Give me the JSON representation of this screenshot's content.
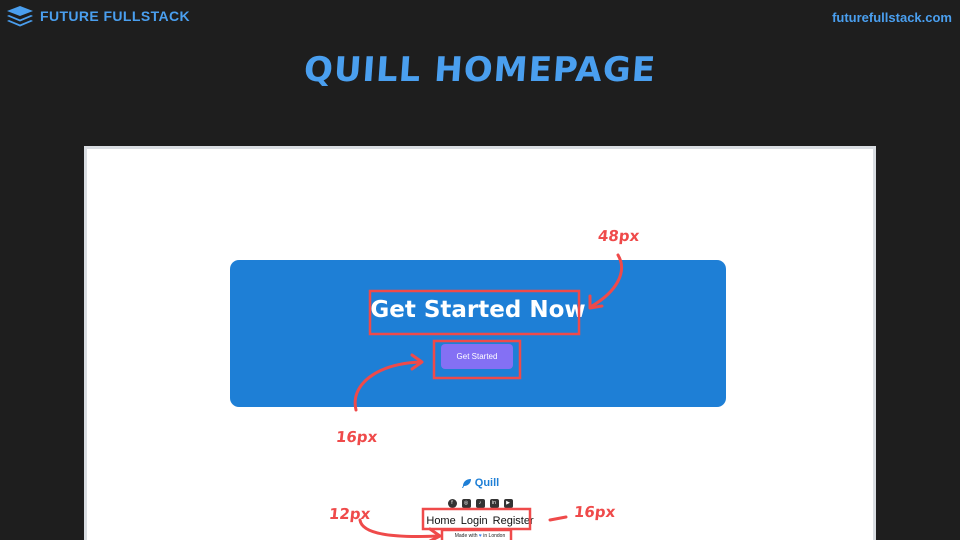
{
  "header": {
    "brand_name": "FUTURE FULLSTACK",
    "brand_icon": "stack-layers-icon",
    "site_url": "futurefullstack.com",
    "title": "QUILL HOMEPAGE"
  },
  "page": {
    "cta": {
      "heading": "Get Started Now",
      "button_label": "Get Started"
    },
    "footer": {
      "logo_icon": "feather-icon",
      "logo_text": "Quill",
      "socials": [
        "facebook-icon",
        "instagram-icon",
        "tiktok-icon",
        "linkedin-icon",
        "youtube-icon"
      ],
      "nav": [
        "Home",
        "Login",
        "Register"
      ],
      "made_with_prefix": "Made with",
      "made_with_suffix": "in London"
    }
  },
  "annotations": {
    "heading_size": "48px",
    "button_size": "16px",
    "nav_size": "16px",
    "made_with_size": "12px"
  },
  "colors": {
    "background": "#1e1e1e",
    "accent": "#4a9fef",
    "cta_blue": "#1e7fd6",
    "button_purple": "#8470f4",
    "annotation_red": "#ef4a4a"
  }
}
